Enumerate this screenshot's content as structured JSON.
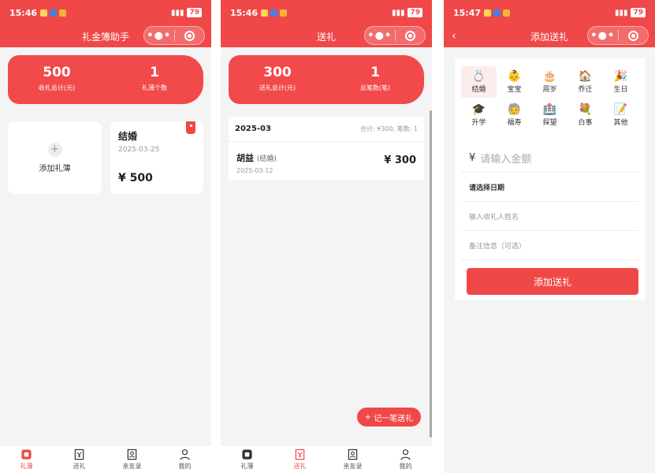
{
  "status": {
    "time1": "15:46",
    "time2": "15:46",
    "time3": "15:47",
    "battery": "79"
  },
  "screen1": {
    "title": "礼金簿助手",
    "summary": {
      "received_total": "500",
      "received_label": "收礼总计(元)",
      "book_count": "1",
      "book_count_label": "礼薄个数"
    },
    "add_book_label": "添加礼薄",
    "book": {
      "name": "结婚",
      "date": "2025-03-25",
      "amount": "¥ 500"
    }
  },
  "screen2": {
    "title": "送礼",
    "summary": {
      "sent_total": "300",
      "sent_label": "送礼总计(元)",
      "count": "1",
      "count_label": "总笔数(笔)"
    },
    "month": "2025-03",
    "month_summary": "合计: ¥300, 笔数: 1",
    "record": {
      "name": "胡益",
      "tag": "(结婚)",
      "date": "2025-03-12",
      "amount": "¥ 300"
    },
    "fab_label": "记一笔送礼"
  },
  "screen3": {
    "title": "添加送礼",
    "categories": [
      {
        "label": "结婚",
        "icon": "ring-icon",
        "glyph": "💍"
      },
      {
        "label": "宝宝",
        "icon": "baby-icon",
        "glyph": "👶"
      },
      {
        "label": "周岁",
        "icon": "cake-icon",
        "glyph": "🎂"
      },
      {
        "label": "乔迁",
        "icon": "house-icon",
        "glyph": "🏠"
      },
      {
        "label": "生日",
        "icon": "party-icon",
        "glyph": "🎉"
      },
      {
        "label": "升学",
        "icon": "graduation-cap-icon",
        "glyph": "🎓"
      },
      {
        "label": "福寿",
        "icon": "elder-icon",
        "glyph": "🧓"
      },
      {
        "label": "探望",
        "icon": "hospital-icon",
        "glyph": "🏥"
      },
      {
        "label": "白事",
        "icon": "flower-icon",
        "glyph": "💐"
      },
      {
        "label": "其他",
        "icon": "memo-icon",
        "glyph": "📝"
      }
    ],
    "amount_prefix": "¥",
    "amount_placeholder": "请输入金额",
    "date_label": "请选择日期",
    "name_placeholder": "输入收礼人姓名",
    "note_placeholder": "备注信息（可选）",
    "submit_label": "添加送礼"
  },
  "tabs": [
    {
      "label": "礼薄",
      "icon": "book-icon"
    },
    {
      "label": "送礼",
      "icon": "gift-icon"
    },
    {
      "label": "亲友录",
      "icon": "contacts-icon"
    },
    {
      "label": "我的",
      "icon": "user-icon"
    }
  ],
  "colors": {
    "accent": "#f04848",
    "background": "#f4f4f4"
  }
}
